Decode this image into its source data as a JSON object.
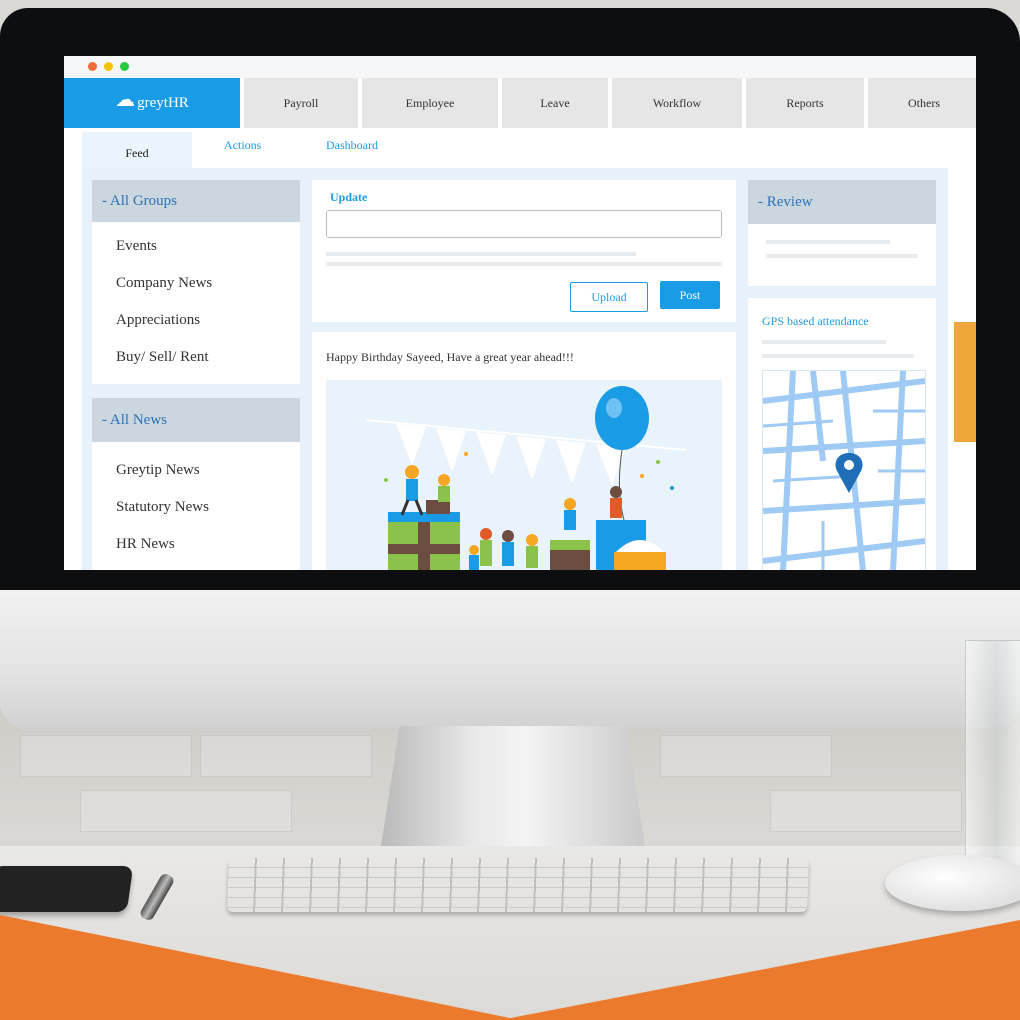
{
  "app": {
    "logo_text": "greytHR",
    "window_dots": [
      "#f26b3a",
      "#f5c400",
      "#27c93f"
    ]
  },
  "nav": {
    "items": [
      "Payroll",
      "Employee",
      "Leave",
      "Workflow",
      "Reports",
      "Others"
    ]
  },
  "subtabs": [
    "Feed",
    "Actions",
    "Dashboard"
  ],
  "groups_panel": {
    "title": "- All Groups",
    "items": [
      "Events",
      "Company News",
      "Appreciations",
      "Buy/ Sell/ Rent"
    ]
  },
  "news_panel": {
    "title": "- All News",
    "items": [
      "Greytip News",
      "Statutory News",
      "HR News"
    ]
  },
  "update_box": {
    "label": "Update",
    "input_value": "",
    "upload_label": "Upload",
    "post_label": "Post"
  },
  "post": {
    "text": "Happy Birthday Sayeed, Have a great year ahead!!!"
  },
  "review_panel": {
    "title": "- Review"
  },
  "gps_panel": {
    "title": "GPS based attendance"
  },
  "colors": {
    "brand_blue": "#1a9be6",
    "accent_orange": "#ec7a2c",
    "panel_header": "#cbd6de"
  }
}
